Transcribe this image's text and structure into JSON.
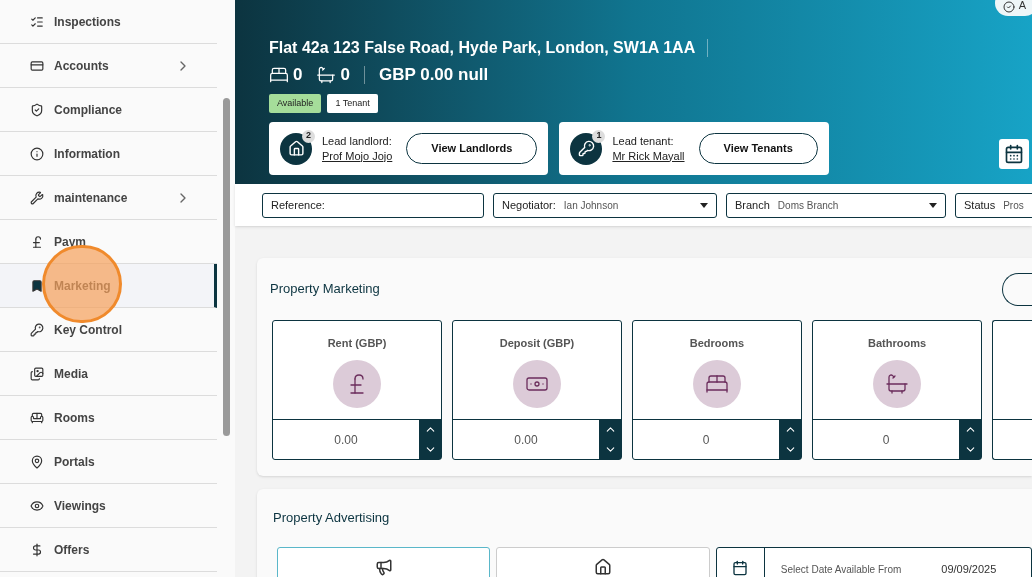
{
  "sidebar": {
    "items": [
      {
        "label": "Inspections",
        "has_children": false,
        "selected": false
      },
      {
        "label": "Accounts",
        "has_children": true,
        "selected": false
      },
      {
        "label": "Compliance",
        "has_children": false,
        "selected": false
      },
      {
        "label": "Information",
        "has_children": false,
        "selected": false
      },
      {
        "label": "maintenance",
        "has_children": true,
        "selected": false
      },
      {
        "label": "Paym",
        "has_children": false,
        "selected": false
      },
      {
        "label": "Marketing",
        "has_children": false,
        "selected": true
      },
      {
        "label": "Key Control",
        "has_children": false,
        "selected": false
      },
      {
        "label": "Media",
        "has_children": false,
        "selected": false
      },
      {
        "label": "Rooms",
        "has_children": false,
        "selected": false
      },
      {
        "label": "Portals",
        "has_children": false,
        "selected": false
      },
      {
        "label": "Viewings",
        "has_children": false,
        "selected": false
      },
      {
        "label": "Offers",
        "has_children": false,
        "selected": false
      }
    ]
  },
  "header": {
    "status_pill": "A",
    "address": "Flat 42a 123 False Road, Hyde Park, London, SW1A 1AA",
    "bedrooms": "0",
    "bathrooms": "0",
    "price": "GBP 0.00 null",
    "badges": [
      {
        "label": "Available",
        "kind": "status"
      },
      {
        "label": "1 Tenant",
        "kind": "plain"
      }
    ],
    "contacts": [
      {
        "count": "2",
        "label": "Lead landlord:",
        "name": "Prof Mojo Jojo",
        "button": "View Landlords"
      },
      {
        "count": "1",
        "label": "Lead tenant:",
        "name": "Mr Rick Mayall",
        "button": "View Tenants"
      }
    ]
  },
  "filters": [
    {
      "label": "Reference:",
      "dropdown": false
    },
    {
      "label": "Negotiator:",
      "value": "Ian Johnson",
      "dropdown": true
    },
    {
      "label": "Branch",
      "value": "Doms Branch",
      "dropdown": true
    },
    {
      "label": "Status",
      "value": "Pros"
    }
  ],
  "marketing": {
    "title": "Property Marketing",
    "fields": [
      {
        "label": "Rent (GBP)",
        "value": "0.00"
      },
      {
        "label": "Deposit (GBP)",
        "value": "0.00"
      },
      {
        "label": "Bedrooms",
        "value": "0"
      },
      {
        "label": "Bathrooms",
        "value": "0"
      }
    ]
  },
  "advertising": {
    "title": "Property Advertising",
    "date_label": "Select Date Available From",
    "date_value": "09/09/2025"
  }
}
